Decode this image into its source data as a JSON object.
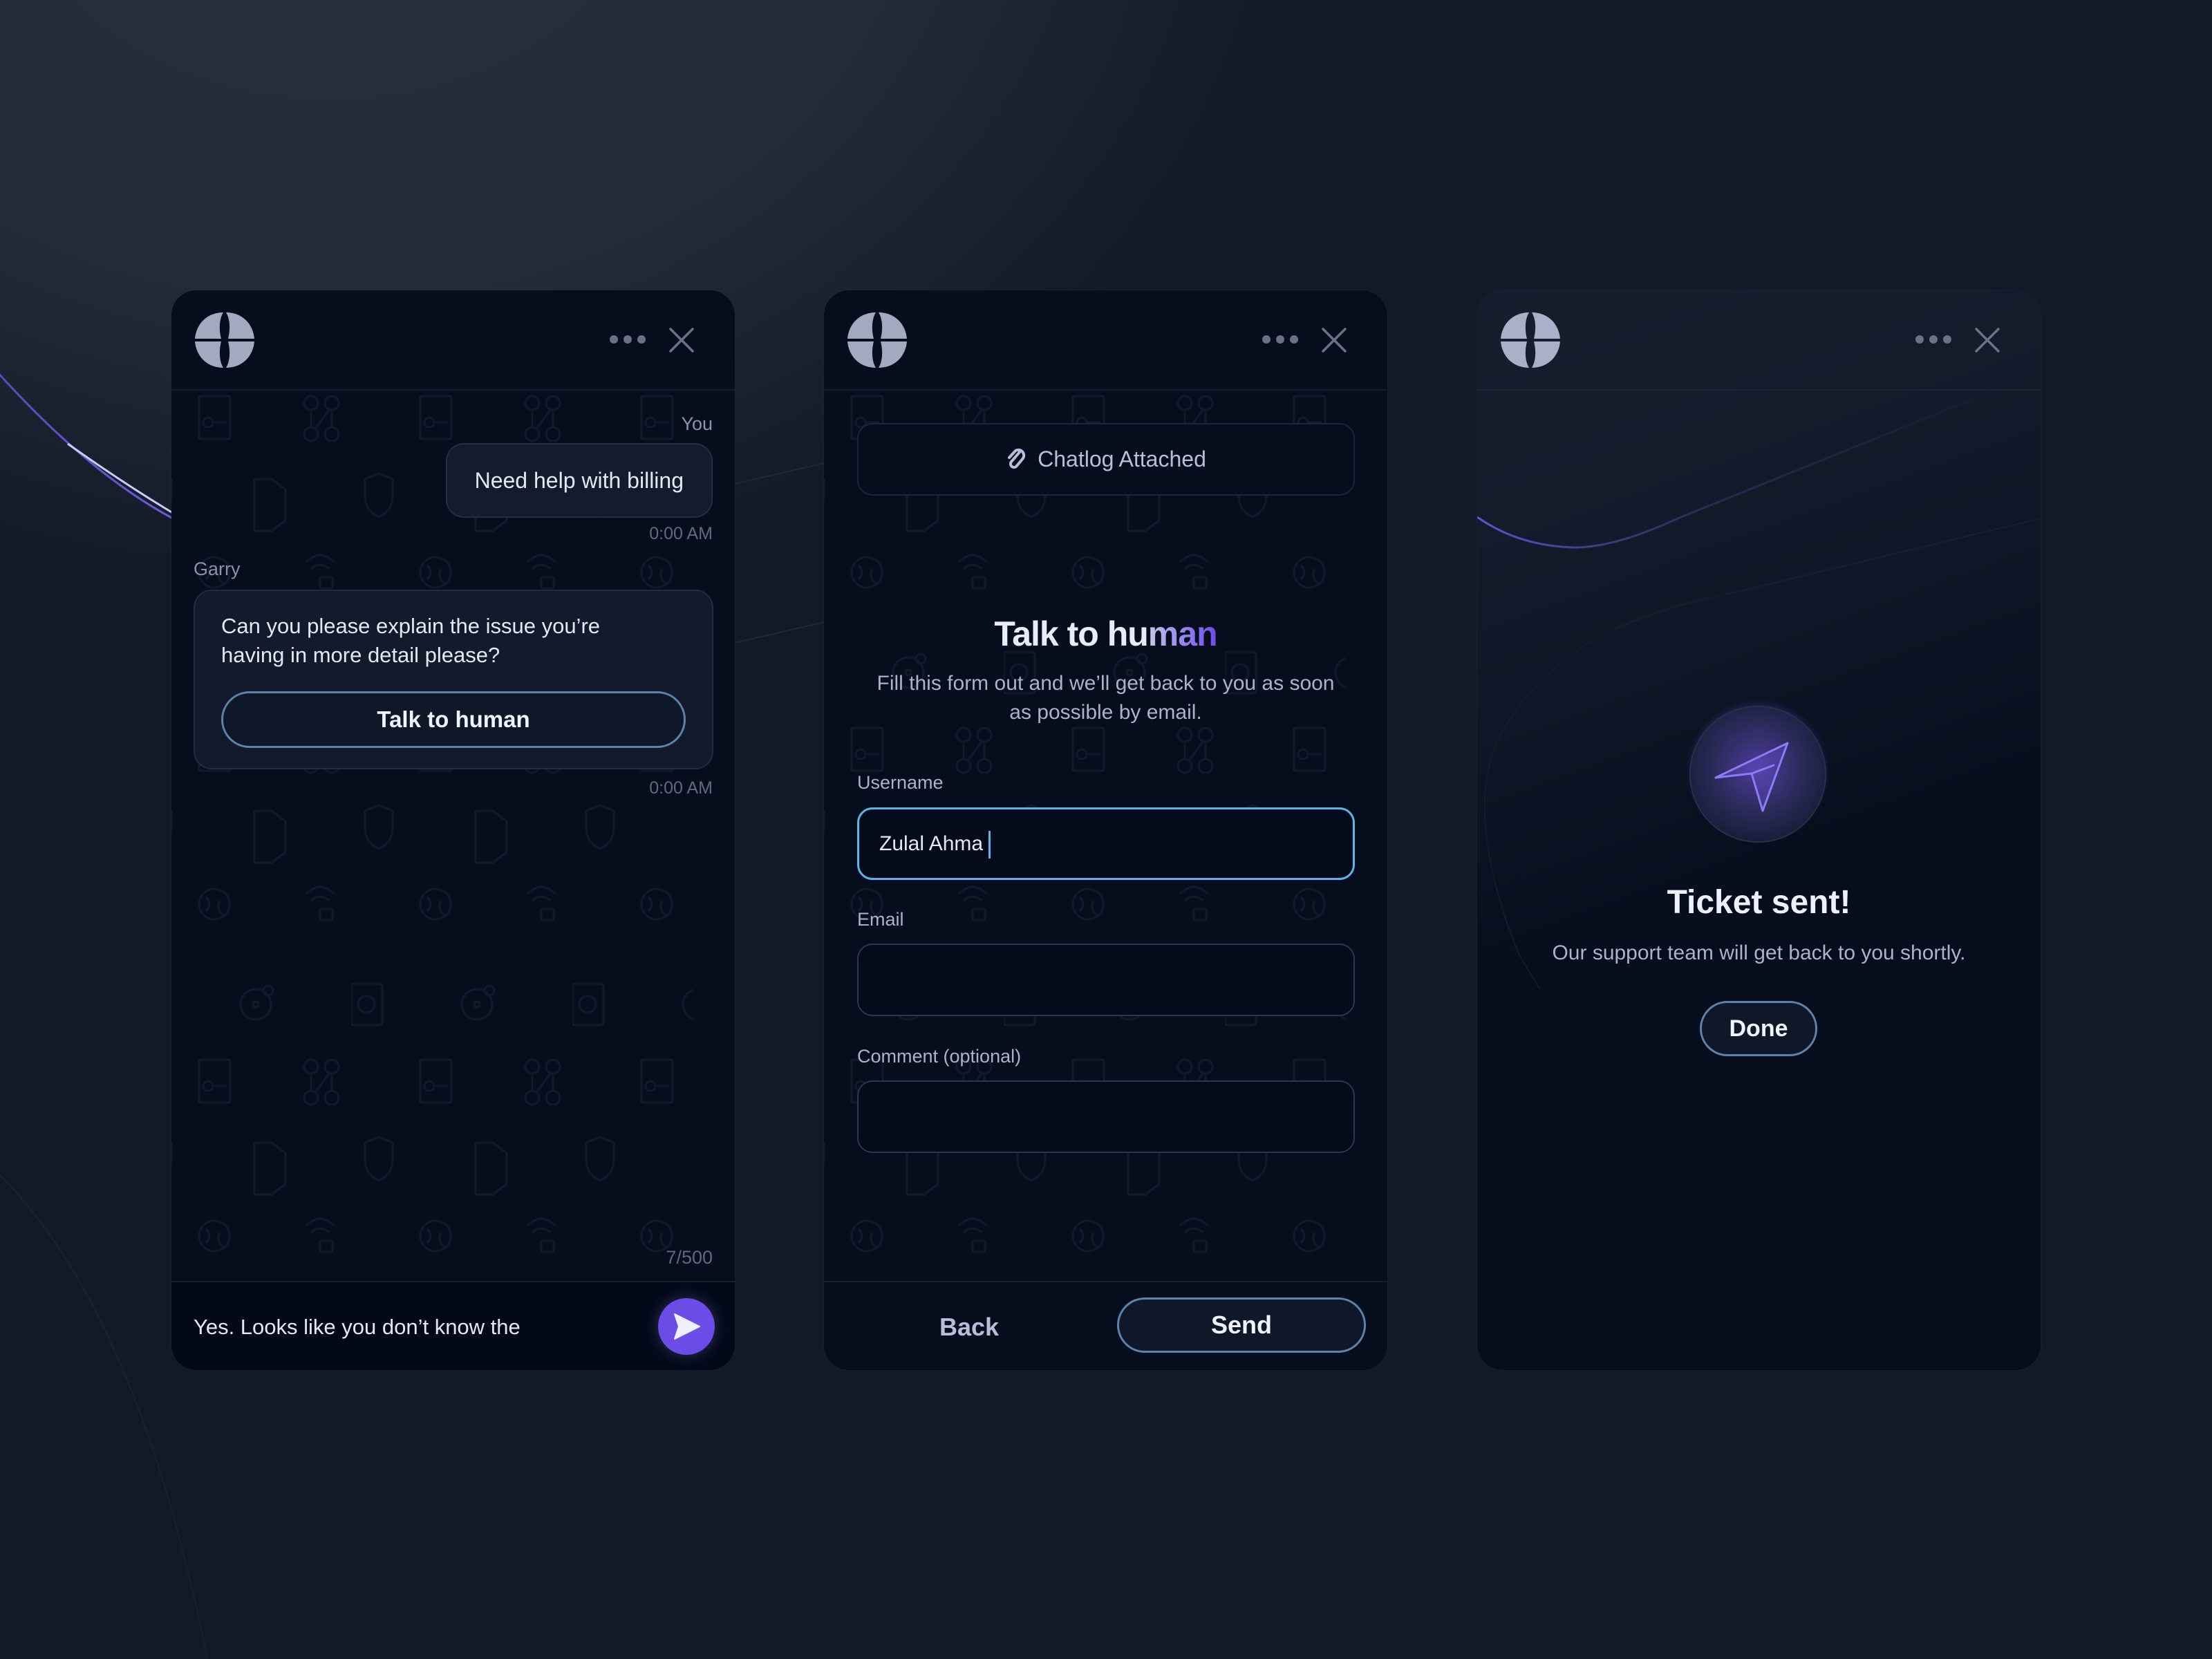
{
  "colors": {
    "accent": "#6b4ce6",
    "focus": "#5ab6e4",
    "button_border": "#5b84ab",
    "panel_bg": "#060d1d",
    "page_bg": "#131a27"
  },
  "icons": {
    "logo": "four-petal-star-logo-icon",
    "more": "more-dots-icon",
    "close": "close-x-icon",
    "send": "paper-plane-icon",
    "attachment": "paperclip-icon",
    "success": "paper-plane-outline-icon"
  },
  "chat": {
    "user_name": "You",
    "user_message": "Need help with billing",
    "user_time": "0:00 AM",
    "agent_name": "Garry",
    "agent_message": "Can you please explain the issue you’re having in more detail please?",
    "agent_action_label": "Talk to human",
    "agent_time": "0:00 AM",
    "char_counter": "7/500",
    "input_value": "Yes. Looks like you don’t know the"
  },
  "form": {
    "attachment_label": "Chatlog Attached",
    "title_plain": "Talk to hu",
    "title_accent": "man",
    "subtitle": "Fill this form out and we’ll get back to you as soon as possible by email.",
    "fields": [
      {
        "label": "Username",
        "value": "Zulal Ahma",
        "focused": true
      },
      {
        "label": "Email",
        "value": ""
      },
      {
        "label": "Comment (optional)",
        "value": ""
      }
    ],
    "back_label": "Back",
    "send_label": "Send"
  },
  "confirmation": {
    "title": "Ticket sent!",
    "subtitle": "Our support team will get back to you shortly.",
    "done_label": "Done"
  }
}
